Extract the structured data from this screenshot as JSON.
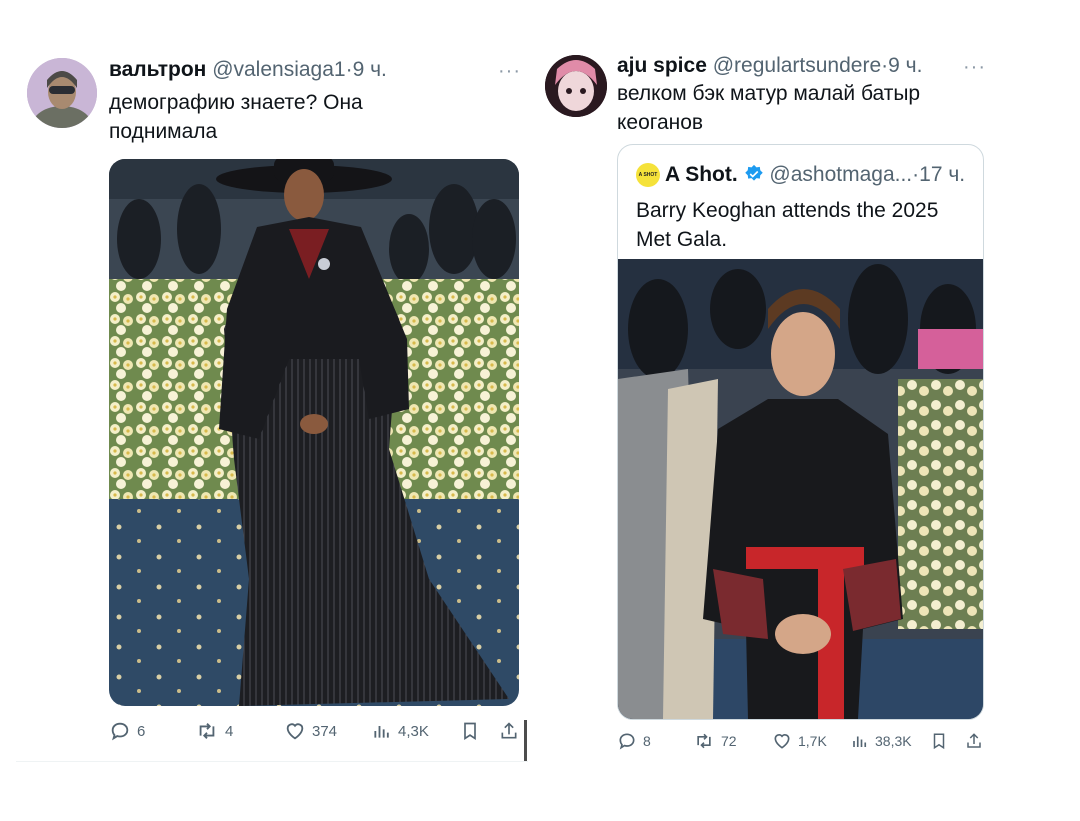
{
  "tweets": [
    {
      "author": {
        "name": "вальтрон",
        "handle": "@valensiaga1",
        "sep": "·",
        "time": "9 ч."
      },
      "more": "···",
      "text": "демографию знаете? Она поднимала",
      "actions": {
        "replies": "6",
        "retweets": "4",
        "likes": "374",
        "views": "4,3K"
      }
    },
    {
      "author": {
        "name": "aju spice",
        "handle": "@regulartsundere",
        "sep": "·",
        "time": "9 ч."
      },
      "more": "···",
      "text": "велком бэк матур малай батыр кеоганов",
      "quote": {
        "name": "A Shot.",
        "handle": "@ashotmaga...",
        "sep": "·",
        "time": "17 ч.",
        "avatar_text": "A SHOT",
        "text": "Barry Keoghan attends the 2025 Met Gala."
      },
      "actions": {
        "replies": "8",
        "retweets": "72",
        "likes": "1,7K",
        "views": "38,3K"
      }
    }
  ],
  "colors": {
    "verified": "#1d9bf0",
    "text": "#0f1419",
    "muted": "#536471"
  },
  "icons": [
    "reply-icon",
    "retweet-icon",
    "like-icon",
    "views-icon",
    "bookmark-icon",
    "share-icon",
    "verified-icon",
    "more-icon"
  ]
}
